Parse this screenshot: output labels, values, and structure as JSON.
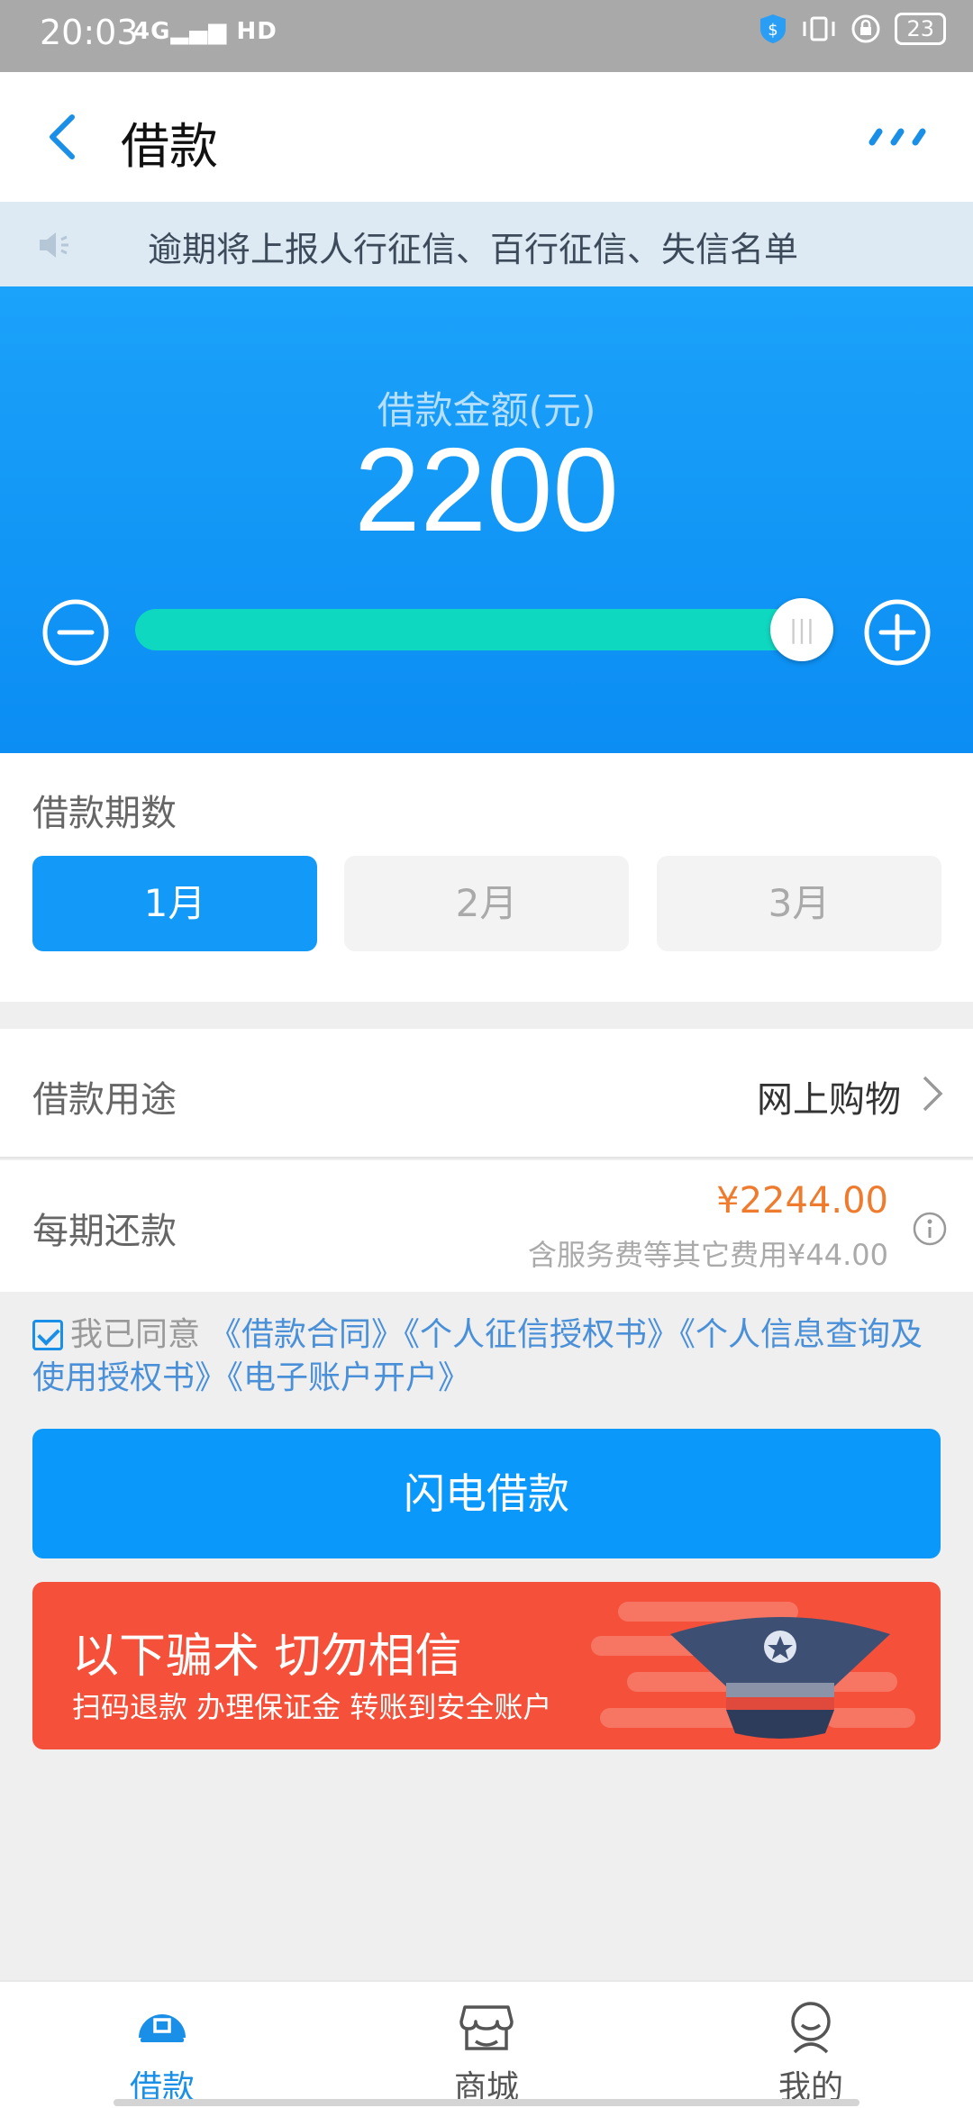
{
  "status": {
    "time": "20:03",
    "signal": "4G",
    "hd": "HD",
    "battery": "23"
  },
  "header": {
    "title": "借款"
  },
  "notice": {
    "text": "逾期将上报人行征信、百行征信、失信名单"
  },
  "loan": {
    "amount_label": "借款金额(元)",
    "amount": "2200",
    "slider_fraction": 1.0
  },
  "term": {
    "label": "借款期数",
    "options": [
      "1月",
      "2月",
      "3月"
    ],
    "selected": "1月"
  },
  "purpose": {
    "label": "借款用途",
    "value": "网上购物"
  },
  "repay": {
    "label": "每期还款",
    "amount": "¥2244.00",
    "note": "含服务费等其它费用¥44.00"
  },
  "agreement": {
    "agreed_text": "我已同意",
    "links": [
      "《借款合同》",
      "《个人征信授权书》",
      "《个人信息查询及使用授权书》",
      "《电子账户开户》"
    ]
  },
  "submit_label": "闪电借款",
  "banner": {
    "title": "以下骗术 切勿相信",
    "subtitle": "扫码退款 办理保证金 转账到安全账户"
  },
  "tabs": [
    {
      "label": "借款",
      "icon": "loan-icon",
      "active": true
    },
    {
      "label": "商城",
      "icon": "store-icon",
      "active": false
    },
    {
      "label": "我的",
      "icon": "profile-icon",
      "active": false
    }
  ],
  "colors": {
    "accent": "#1399f7",
    "slider": "#0fd8c0",
    "warning": "#ee7b2e",
    "banner": "#f4503a"
  }
}
